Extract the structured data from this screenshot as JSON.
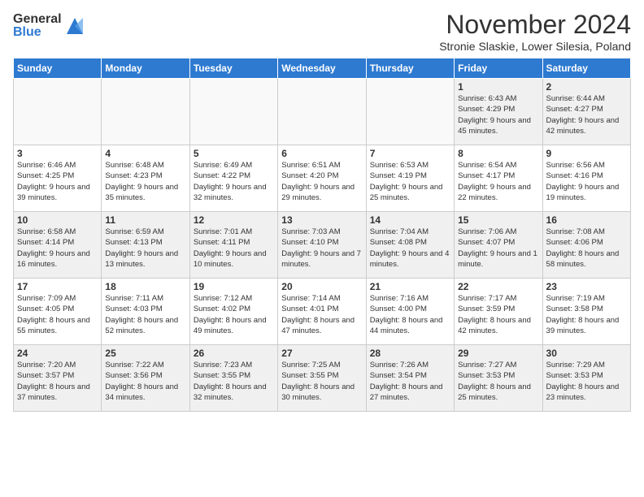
{
  "header": {
    "logo_general": "General",
    "logo_blue": "Blue",
    "month": "November 2024",
    "location": "Stronie Slaskie, Lower Silesia, Poland"
  },
  "weekdays": [
    "Sunday",
    "Monday",
    "Tuesday",
    "Wednesday",
    "Thursday",
    "Friday",
    "Saturday"
  ],
  "weeks": [
    [
      {
        "day": "",
        "empty": true
      },
      {
        "day": "",
        "empty": true
      },
      {
        "day": "",
        "empty": true
      },
      {
        "day": "",
        "empty": true
      },
      {
        "day": "",
        "empty": true
      },
      {
        "day": "1",
        "sunrise": "6:43 AM",
        "sunset": "4:29 PM",
        "daylight": "9 hours and 45 minutes."
      },
      {
        "day": "2",
        "sunrise": "6:44 AM",
        "sunset": "4:27 PM",
        "daylight": "9 hours and 42 minutes."
      }
    ],
    [
      {
        "day": "3",
        "sunrise": "6:46 AM",
        "sunset": "4:25 PM",
        "daylight": "9 hours and 39 minutes."
      },
      {
        "day": "4",
        "sunrise": "6:48 AM",
        "sunset": "4:23 PM",
        "daylight": "9 hours and 35 minutes."
      },
      {
        "day": "5",
        "sunrise": "6:49 AM",
        "sunset": "4:22 PM",
        "daylight": "9 hours and 32 minutes."
      },
      {
        "day": "6",
        "sunrise": "6:51 AM",
        "sunset": "4:20 PM",
        "daylight": "9 hours and 29 minutes."
      },
      {
        "day": "7",
        "sunrise": "6:53 AM",
        "sunset": "4:19 PM",
        "daylight": "9 hours and 25 minutes."
      },
      {
        "day": "8",
        "sunrise": "6:54 AM",
        "sunset": "4:17 PM",
        "daylight": "9 hours and 22 minutes."
      },
      {
        "day": "9",
        "sunrise": "6:56 AM",
        "sunset": "4:16 PM",
        "daylight": "9 hours and 19 minutes."
      }
    ],
    [
      {
        "day": "10",
        "sunrise": "6:58 AM",
        "sunset": "4:14 PM",
        "daylight": "9 hours and 16 minutes."
      },
      {
        "day": "11",
        "sunrise": "6:59 AM",
        "sunset": "4:13 PM",
        "daylight": "9 hours and 13 minutes."
      },
      {
        "day": "12",
        "sunrise": "7:01 AM",
        "sunset": "4:11 PM",
        "daylight": "9 hours and 10 minutes."
      },
      {
        "day": "13",
        "sunrise": "7:03 AM",
        "sunset": "4:10 PM",
        "daylight": "9 hours and 7 minutes."
      },
      {
        "day": "14",
        "sunrise": "7:04 AM",
        "sunset": "4:08 PM",
        "daylight": "9 hours and 4 minutes."
      },
      {
        "day": "15",
        "sunrise": "7:06 AM",
        "sunset": "4:07 PM",
        "daylight": "9 hours and 1 minute."
      },
      {
        "day": "16",
        "sunrise": "7:08 AM",
        "sunset": "4:06 PM",
        "daylight": "8 hours and 58 minutes."
      }
    ],
    [
      {
        "day": "17",
        "sunrise": "7:09 AM",
        "sunset": "4:05 PM",
        "daylight": "8 hours and 55 minutes."
      },
      {
        "day": "18",
        "sunrise": "7:11 AM",
        "sunset": "4:03 PM",
        "daylight": "8 hours and 52 minutes."
      },
      {
        "day": "19",
        "sunrise": "7:12 AM",
        "sunset": "4:02 PM",
        "daylight": "8 hours and 49 minutes."
      },
      {
        "day": "20",
        "sunrise": "7:14 AM",
        "sunset": "4:01 PM",
        "daylight": "8 hours and 47 minutes."
      },
      {
        "day": "21",
        "sunrise": "7:16 AM",
        "sunset": "4:00 PM",
        "daylight": "8 hours and 44 minutes."
      },
      {
        "day": "22",
        "sunrise": "7:17 AM",
        "sunset": "3:59 PM",
        "daylight": "8 hours and 42 minutes."
      },
      {
        "day": "23",
        "sunrise": "7:19 AM",
        "sunset": "3:58 PM",
        "daylight": "8 hours and 39 minutes."
      }
    ],
    [
      {
        "day": "24",
        "sunrise": "7:20 AM",
        "sunset": "3:57 PM",
        "daylight": "8 hours and 37 minutes."
      },
      {
        "day": "25",
        "sunrise": "7:22 AM",
        "sunset": "3:56 PM",
        "daylight": "8 hours and 34 minutes."
      },
      {
        "day": "26",
        "sunrise": "7:23 AM",
        "sunset": "3:55 PM",
        "daylight": "8 hours and 32 minutes."
      },
      {
        "day": "27",
        "sunrise": "7:25 AM",
        "sunset": "3:55 PM",
        "daylight": "8 hours and 30 minutes."
      },
      {
        "day": "28",
        "sunrise": "7:26 AM",
        "sunset": "3:54 PM",
        "daylight": "8 hours and 27 minutes."
      },
      {
        "day": "29",
        "sunrise": "7:27 AM",
        "sunset": "3:53 PM",
        "daylight": "8 hours and 25 minutes."
      },
      {
        "day": "30",
        "sunrise": "7:29 AM",
        "sunset": "3:53 PM",
        "daylight": "8 hours and 23 minutes."
      }
    ]
  ]
}
